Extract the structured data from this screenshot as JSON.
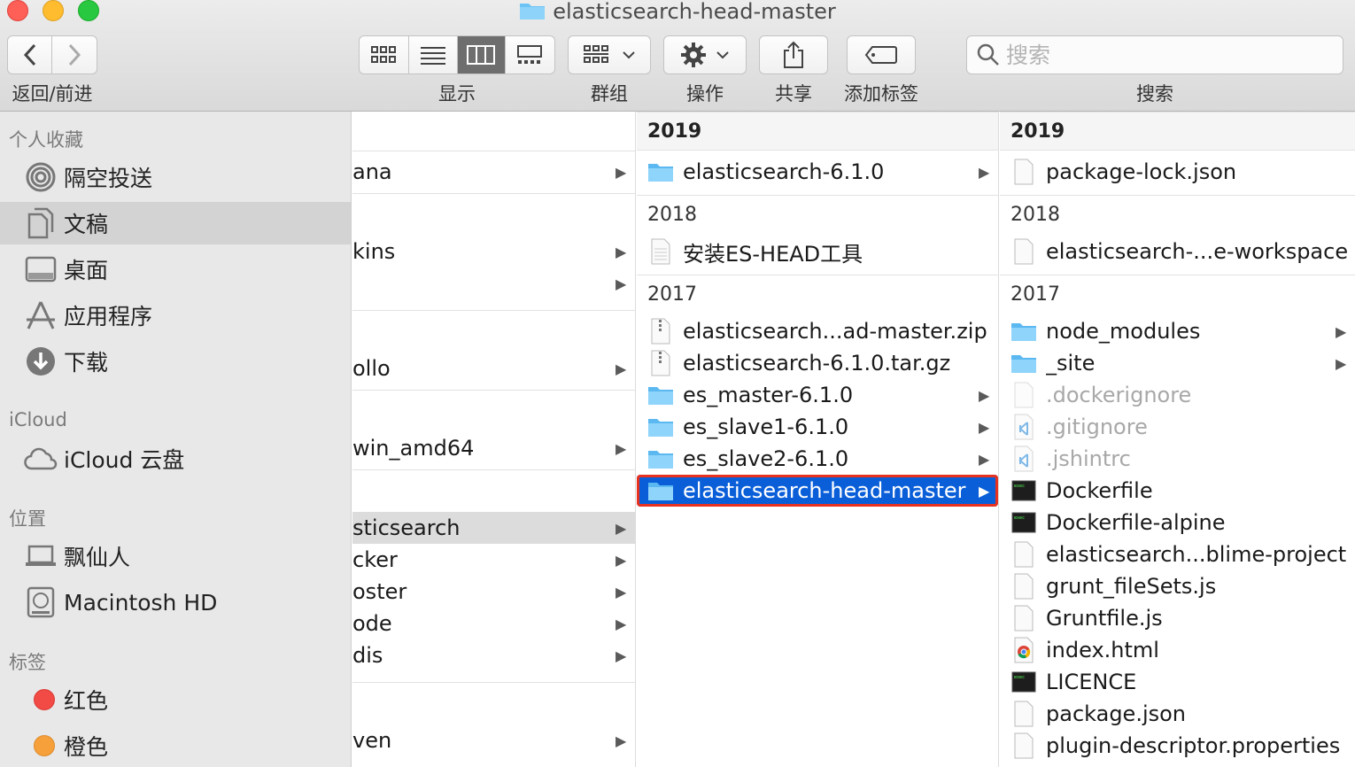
{
  "window": {
    "title": "elasticsearch-head-master"
  },
  "toolbar": {
    "nav_label": "返回/前进",
    "view_label": "显示",
    "group_label": "群组",
    "action_label": "操作",
    "share_label": "共享",
    "tag_label": "添加标签",
    "search_label": "搜索",
    "search_placeholder": "搜索"
  },
  "sidebar": {
    "favorites_header": "个人收藏",
    "favorites": [
      {
        "label": "隔空投送",
        "icon": "airdrop-icon"
      },
      {
        "label": "文稿",
        "icon": "documents-icon"
      },
      {
        "label": "桌面",
        "icon": "desktop-icon"
      },
      {
        "label": "应用程序",
        "icon": "applications-icon"
      },
      {
        "label": "下载",
        "icon": "downloads-icon"
      }
    ],
    "icloud_header": "iCloud",
    "icloud": [
      {
        "label": "iCloud 云盘",
        "icon": "cloud-icon"
      }
    ],
    "locations_header": "位置",
    "locations": [
      {
        "label": "飘仙人",
        "icon": "laptop-icon"
      },
      {
        "label": "Macintosh HD",
        "icon": "harddisk-icon"
      }
    ],
    "tags_header": "标签",
    "tags": [
      {
        "label": "红色",
        "color": "#f24a44"
      },
      {
        "label": "橙色",
        "color": "#f6a03b"
      }
    ]
  },
  "column1": {
    "items": [
      "ana",
      "kins",
      "",
      "ollo",
      "win_amd64",
      "sticsearch",
      "cker",
      "oster",
      "ode",
      "dis",
      "ven"
    ]
  },
  "column2": {
    "groups": [
      {
        "header": "2019",
        "items": [
          {
            "name": "elasticsearch-6.1.0",
            "type": "folder"
          }
        ]
      },
      {
        "header": "2018",
        "items": [
          {
            "name": "安装ES-HEAD工具",
            "type": "doc"
          }
        ]
      },
      {
        "header": "2017",
        "items": [
          {
            "name": "elasticsearch...ad-master.zip",
            "type": "zip"
          },
          {
            "name": "elasticsearch-6.1.0.tar.gz",
            "type": "zip"
          },
          {
            "name": "es_master-6.1.0",
            "type": "folder"
          },
          {
            "name": "es_slave1-6.1.0",
            "type": "folder"
          },
          {
            "name": "es_slave2-6.1.0",
            "type": "folder"
          },
          {
            "name": "elasticsearch-head-master",
            "type": "folder",
            "selected": true
          }
        ]
      }
    ]
  },
  "column3": {
    "groups": [
      {
        "header": "2019",
        "items": [
          {
            "name": "package-lock.json",
            "type": "file"
          }
        ]
      },
      {
        "header": "2018",
        "items": [
          {
            "name": "elasticsearch-...e-workspace",
            "type": "file"
          }
        ]
      },
      {
        "header": "2017",
        "items": [
          {
            "name": "node_modules",
            "type": "folder"
          },
          {
            "name": "_site",
            "type": "folder"
          },
          {
            "name": ".dockerignore",
            "type": "file",
            "hidden": true
          },
          {
            "name": ".gitignore",
            "type": "vscode",
            "hidden": true
          },
          {
            "name": ".jshintrc",
            "type": "vscode",
            "hidden": true
          },
          {
            "name": "Dockerfile",
            "type": "exec"
          },
          {
            "name": "Dockerfile-alpine",
            "type": "exec"
          },
          {
            "name": "elasticsearch...blime-project",
            "type": "file"
          },
          {
            "name": "grunt_fileSets.js",
            "type": "file"
          },
          {
            "name": "Gruntfile.js",
            "type": "file"
          },
          {
            "name": "index.html",
            "type": "chrome"
          },
          {
            "name": "LICENCE",
            "type": "exec"
          },
          {
            "name": "package.json",
            "type": "file"
          },
          {
            "name": "plugin-descriptor.properties",
            "type": "file"
          }
        ]
      }
    ]
  }
}
